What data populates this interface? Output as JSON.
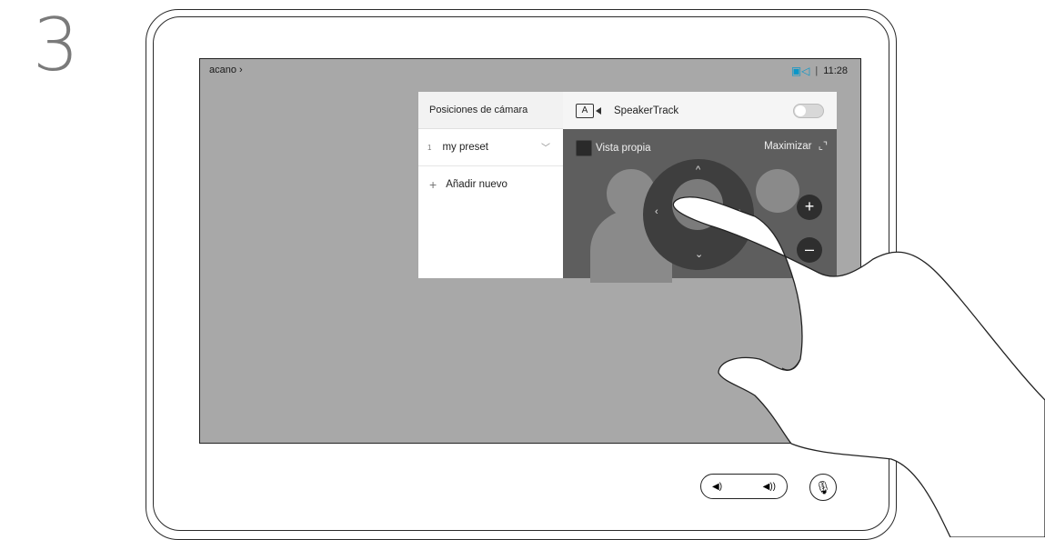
{
  "step_number": "3",
  "status_bar": {
    "left_label": "acano",
    "left_chevron": "›",
    "camera_status_icon": "camera-icon",
    "time": "11:28"
  },
  "camera_panel": {
    "presets_title": "Posiciones de cámara",
    "preset_items": [
      {
        "number": "1",
        "label": "my preset"
      }
    ],
    "add_new_label": "Añadir nuevo",
    "speakertrack_label": "SpeakerTrack",
    "speakertrack_enabled": false,
    "self_view_label": "Vista propia",
    "maximize_label": "Maximizar"
  },
  "controls": {
    "zoom_in": "+",
    "zoom_out": "–",
    "up": "^",
    "down": "⌄",
    "left": "‹",
    "right": "›"
  },
  "colors": {
    "screen_bg": "#a8a8a8",
    "accent": "#0a96c8",
    "panel_dark": "#5e5e5e"
  }
}
